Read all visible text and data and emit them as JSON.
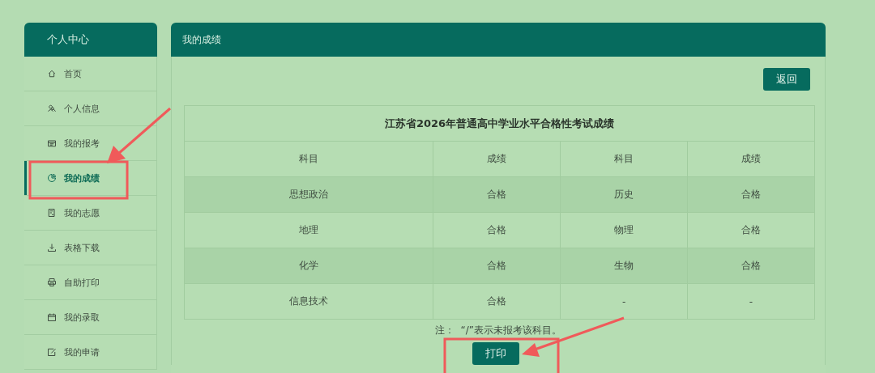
{
  "sidebar": {
    "title": "个人中心",
    "items": [
      {
        "label": "首页",
        "selected": false
      },
      {
        "label": "个人信息",
        "selected": false
      },
      {
        "label": "我的报考",
        "selected": false
      },
      {
        "label": "我的成绩",
        "selected": true
      },
      {
        "label": "我的志愿",
        "selected": false
      },
      {
        "label": "表格下载",
        "selected": false
      },
      {
        "label": "自助打印",
        "selected": false
      },
      {
        "label": "我的录取",
        "selected": false
      },
      {
        "label": "我的申请",
        "selected": false
      }
    ]
  },
  "panel": {
    "title": "我的成绩",
    "back_button": "返回",
    "table": {
      "title": "江苏省2026年普通高中学业水平合格性考试成绩",
      "columns": [
        "科目",
        "成绩",
        "科目",
        "成绩"
      ],
      "rows": [
        [
          "思想政治",
          "合格",
          "历史",
          "合格"
        ],
        [
          "地理",
          "合格",
          "物理",
          "合格"
        ],
        [
          "化学",
          "合格",
          "生物",
          "合格"
        ],
        [
          "信息技术",
          "合格",
          "-",
          "-"
        ]
      ]
    },
    "note": "注：  “/”表示未报考该科目。",
    "print_button": "打印"
  }
}
